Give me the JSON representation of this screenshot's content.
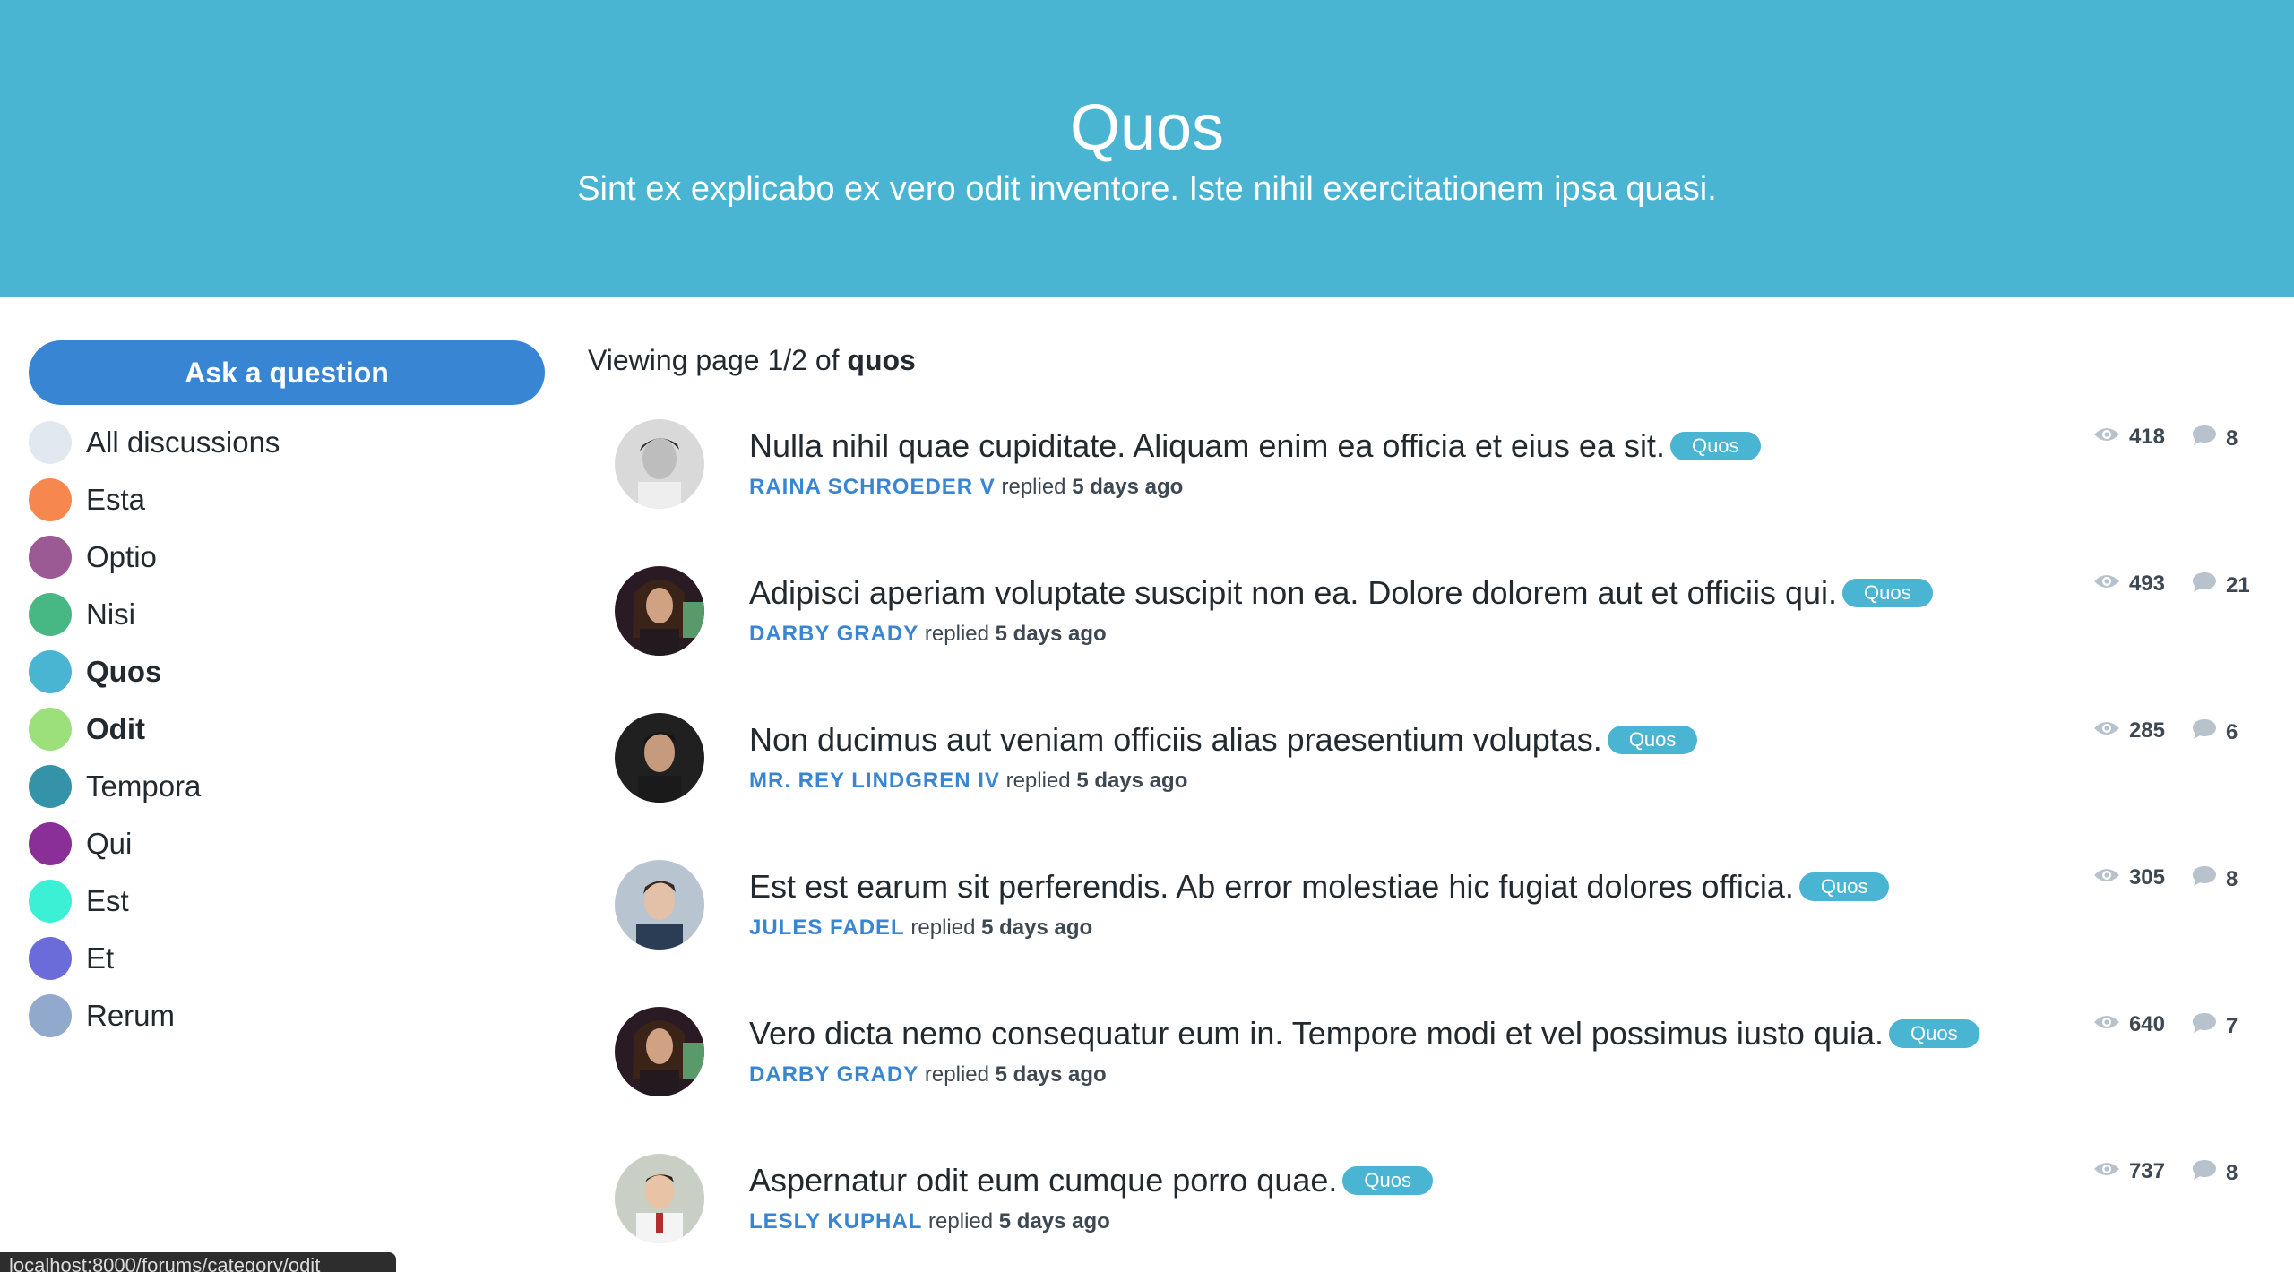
{
  "hero": {
    "title": "Quos",
    "subtitle": "Sint ex explicabo ex vero odit inventore. Iste nihil exercitationem ipsa quasi.",
    "background_color": "#4ab4d3"
  },
  "sidebar": {
    "ask_button_label": "Ask a question",
    "categories": [
      {
        "label": "All discussions",
        "color": "#e2e8f0",
        "bold": false
      },
      {
        "label": "Esta",
        "color": "#f6874f",
        "bold": false
      },
      {
        "label": "Optio",
        "color": "#9b5a93",
        "bold": false
      },
      {
        "label": "Nisi",
        "color": "#47b883",
        "bold": false
      },
      {
        "label": "Quos",
        "color": "#4ab4d3",
        "bold": true
      },
      {
        "label": "Odit",
        "color": "#9be07a",
        "bold": true
      },
      {
        "label": "Tempora",
        "color": "#3493a8",
        "bold": false
      },
      {
        "label": "Qui",
        "color": "#8a2f98",
        "bold": false
      },
      {
        "label": "Est",
        "color": "#3cf0d6",
        "bold": false
      },
      {
        "label": "Et",
        "color": "#6b6bd9",
        "bold": false
      },
      {
        "label": "Rerum",
        "color": "#91a9cd",
        "bold": false
      }
    ]
  },
  "main": {
    "page_info_prefix": "Viewing page 1/2 of ",
    "page_info_category": "quos",
    "threads": [
      {
        "title": "Nulla nihil quae cupiditate. Aliquam enim ea officia et eius ea sit.",
        "tag": "Quos",
        "author": "RAINA SCHROEDER V",
        "replied_text": "replied",
        "time": "5 days ago",
        "views": "418",
        "replies": "8",
        "avatar": "avatar-1"
      },
      {
        "title": "Adipisci aperiam voluptate suscipit non ea. Dolore dolorem aut et officiis qui.",
        "tag": "Quos",
        "author": "DARBY GRADY",
        "replied_text": "replied",
        "time": "5 days ago",
        "views": "493",
        "replies": "21",
        "avatar": "avatar-2"
      },
      {
        "title": "Non ducimus aut veniam officiis alias praesentium voluptas.",
        "tag": "Quos",
        "author": "MR. REY LINDGREN IV",
        "replied_text": "replied",
        "time": "5 days ago",
        "views": "285",
        "replies": "6",
        "avatar": "avatar-3"
      },
      {
        "title": "Est est earum sit perferendis. Ab error molestiae hic fugiat dolores officia.",
        "tag": "Quos",
        "author": "JULES FADEL",
        "replied_text": "replied",
        "time": "5 days ago",
        "views": "305",
        "replies": "8",
        "avatar": "avatar-4"
      },
      {
        "title": "Vero dicta nemo consequatur eum in. Tempore modi et vel possimus iusto quia.",
        "tag": "Quos",
        "author": "DARBY GRADY",
        "replied_text": "replied",
        "time": "5 days ago",
        "views": "640",
        "replies": "7",
        "avatar": "avatar-2"
      },
      {
        "title": "Aspernatur odit eum cumque porro quae.",
        "tag": "Quos",
        "author": "LESLY KUPHAL",
        "replied_text": "replied",
        "time": "5 days ago",
        "views": "737",
        "replies": "8",
        "avatar": "avatar-6"
      }
    ]
  },
  "status_bar": {
    "url": "localhost:8000/forums/category/odit"
  }
}
